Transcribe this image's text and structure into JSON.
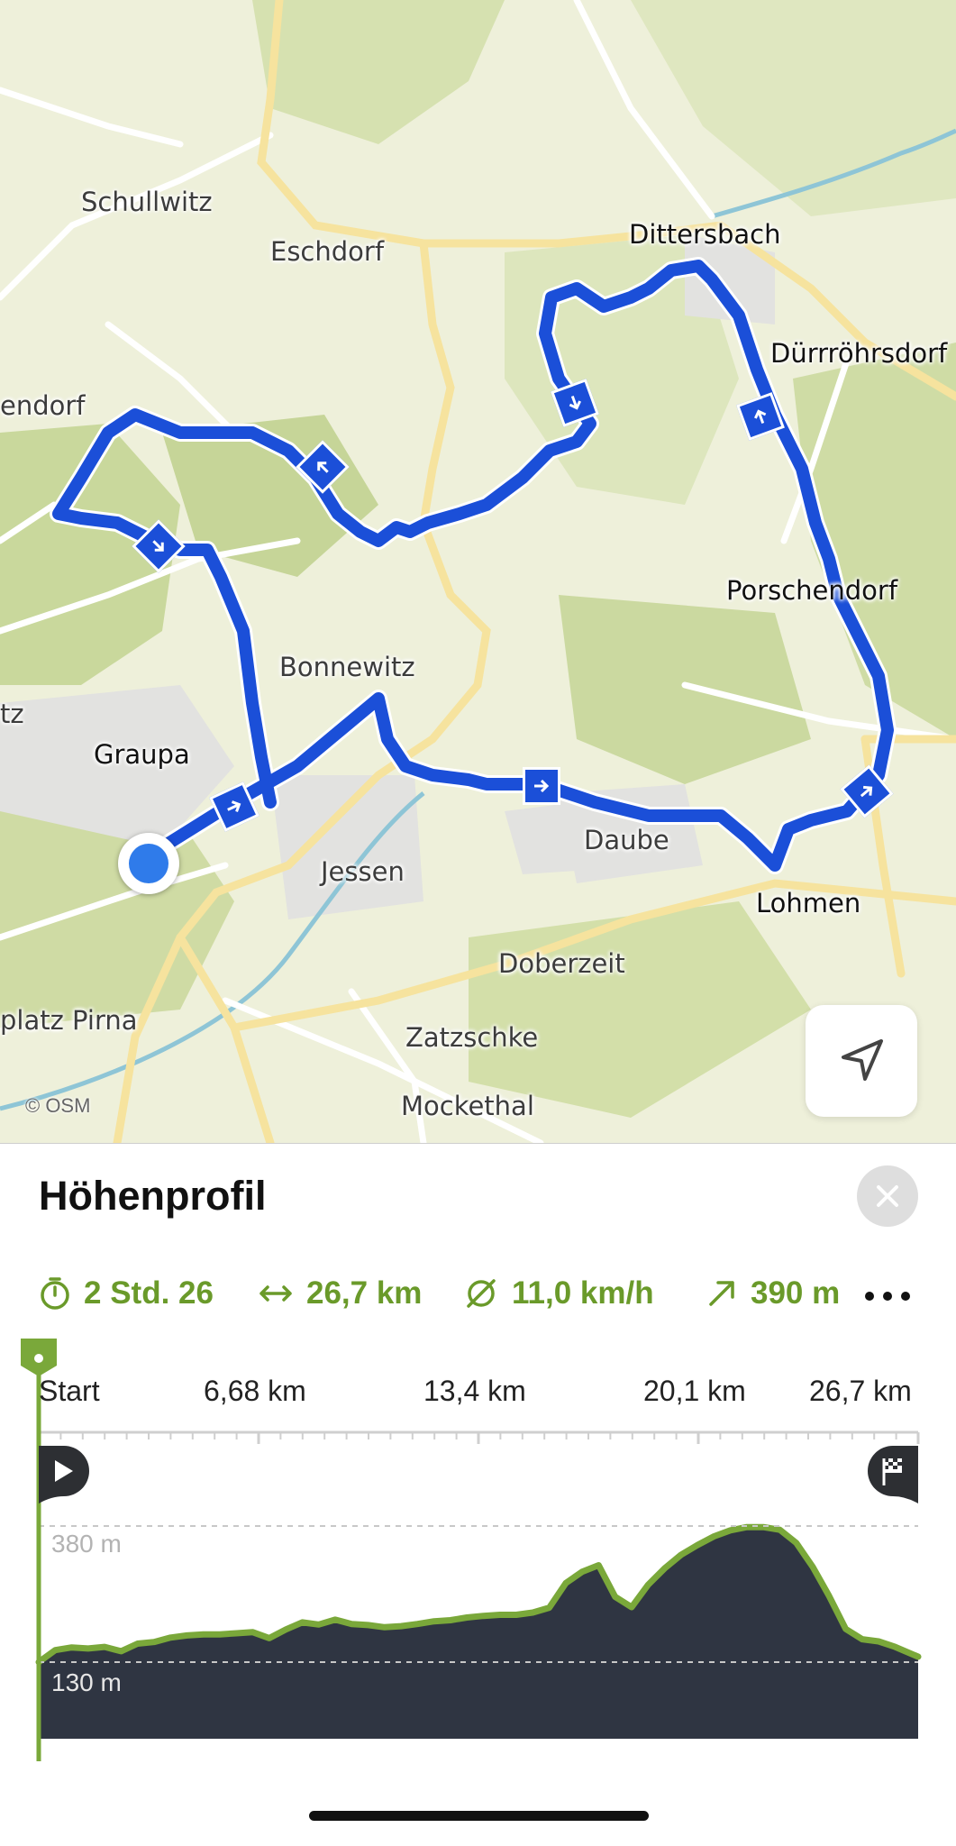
{
  "map": {
    "attribution": "© OSM",
    "places": {
      "schullwitz": "Schullwitz",
      "eschdorf": "Eschdorf",
      "dittersbach": "Dittersbach",
      "duerrroehrsdorf": "Dürrröhrsdorf",
      "endorf": "endorf",
      "porschendorf": "Porschendorf",
      "bonnewitz": "Bonnewitz",
      "graupa": "Graupa",
      "tz": "tz",
      "daube": "Daube",
      "jessen": "Jessen",
      "lohmen": "Lohmen",
      "doberzeit": "Doberzeit",
      "platz_pirna": "platz Pirna",
      "zatzschke": "Zatzschke",
      "mockethal": "Mockethal"
    },
    "icons": {
      "locate": "navigation-arrow-icon",
      "direction": "direction-arrow-icon",
      "position": "current-location-icon"
    },
    "colors": {
      "route": "#1b4fd8",
      "location": "#2f7bea"
    }
  },
  "panel": {
    "title": "Höhenprofil",
    "close_icon": "close-icon",
    "stats": {
      "duration": "2 Std. 26",
      "distance": "26,7 km",
      "avg_speed": "11,0 km/h",
      "ascent": "390 m"
    },
    "more_icon": "more-icon",
    "accent_color": "#7aa83a"
  },
  "chart_data": {
    "type": "area",
    "x_ticks": [
      "Start",
      "6,68 km",
      "13,4 km",
      "20,1 km",
      "26,7 km"
    ],
    "y_labels": [
      "380 m",
      "130 m"
    ],
    "x_unit": "km",
    "y_unit": "m",
    "xlim": [
      0,
      26.7
    ],
    "x": [
      0,
      0.5,
      1.0,
      1.5,
      2.0,
      2.5,
      3.0,
      3.5,
      4.0,
      4.5,
      5.0,
      5.5,
      6.0,
      6.5,
      7.0,
      7.5,
      8.0,
      8.5,
      9.0,
      9.5,
      10.0,
      10.5,
      11.0,
      11.5,
      12.0,
      12.5,
      13.0,
      13.5,
      14.0,
      14.5,
      15.0,
      15.5,
      16.0,
      16.5,
      17.0,
      17.5,
      18.0,
      18.5,
      19.0,
      19.5,
      20.0,
      20.5,
      21.0,
      21.5,
      22.0,
      22.5,
      23.0,
      23.5,
      24.0,
      24.5,
      25.0,
      25.5,
      26.0,
      26.7
    ],
    "y": [
      130,
      152,
      157,
      155,
      158,
      150,
      164,
      167,
      175,
      179,
      181,
      181,
      183,
      185,
      174,
      190,
      203,
      199,
      208,
      200,
      198,
      194,
      196,
      200,
      205,
      207,
      212,
      215,
      217,
      217,
      221,
      230,
      275,
      296,
      308,
      250,
      231,
      272,
      302,
      327,
      345,
      361,
      372,
      378,
      378,
      373,
      349,
      305,
      251,
      191,
      172,
      168,
      158,
      140
    ],
    "series": [
      {
        "values_ref": "y"
      }
    ],
    "legend": "none",
    "markers": {
      "start": "play-icon",
      "finish": "finish-flag-icon"
    }
  }
}
